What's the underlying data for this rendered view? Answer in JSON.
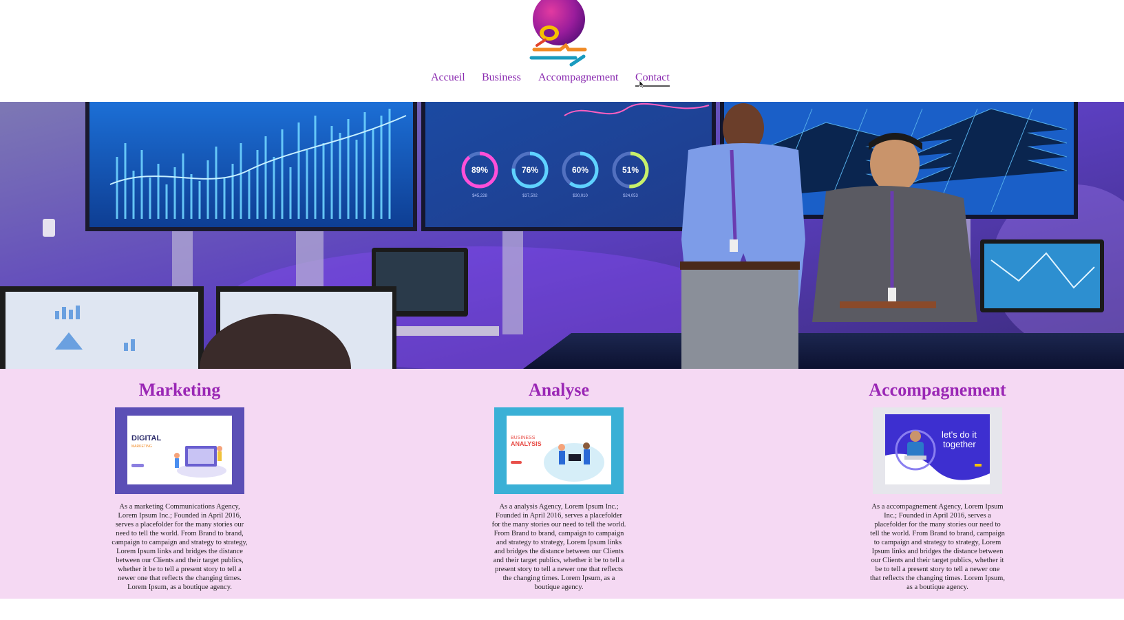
{
  "nav": {
    "items": [
      {
        "label": "Accueil"
      },
      {
        "label": "Business"
      },
      {
        "label": "Accompagnement"
      },
      {
        "label": "Contact"
      }
    ],
    "active": "Contact"
  },
  "hero": {
    "gauges": [
      "89%",
      "76%",
      "60%",
      "51%"
    ],
    "gauge_captions": [
      "$45,228",
      "$37,502",
      "$30,010",
      "$24,053"
    ]
  },
  "features": [
    {
      "title": "Marketing",
      "thumb_title": "DIGITAL",
      "thumb_sub": "MARKETING",
      "text": "As a marketing Communications Agency, Lorem Ipsum Inc.; Founded in April 2016, serves a placefolder for the many stories our need to tell the world. From Brand to brand, campaign to campaign and strategy to strategy, Lorem Ipsum links and bridges the distance between our Clients and their target publics, whether it be to tell a present story to tell a newer one that reflects the changing times. Lorem Ipsum, as a boutique agency."
    },
    {
      "title": "Analyse",
      "thumb_title": "BUSINESS",
      "thumb_sub": "ANALYSIS",
      "text": "As a analysis Agency, Lorem Ipsum Inc.; Founded in April 2016, serves a placefolder for the many stories our need to tell the world. From Brand to brand, campaign to campaign and strategy to strategy, Lorem Ipsum links and bridges the distance between our Clients and their target publics, whether it be to tell a present story to tell a newer one that reflects the changing times. Lorem Ipsum, as a boutique agency."
    },
    {
      "title": "Accompagnement",
      "thumb_title": "let's do it",
      "thumb_sub": "together",
      "text": "As a accompagnement Agency, Lorem Ipsum Inc.; Founded in April 2016, serves a placefolder for the many stories our need to tell the world. From Brand to brand, campaign to campaign and strategy to strategy, Lorem Ipsum links and bridges the distance between our Clients and their target publics, whether it be to tell a present story to tell a newer one that reflects the changing times. Lorem Ipsum, as a boutique agency."
    }
  ],
  "colors": {
    "nav_text": "#8a2bb0",
    "feature_title": "#9a27b5",
    "feature_bg": "#f5d9f3",
    "hero_purple": "#5b3fbf"
  }
}
